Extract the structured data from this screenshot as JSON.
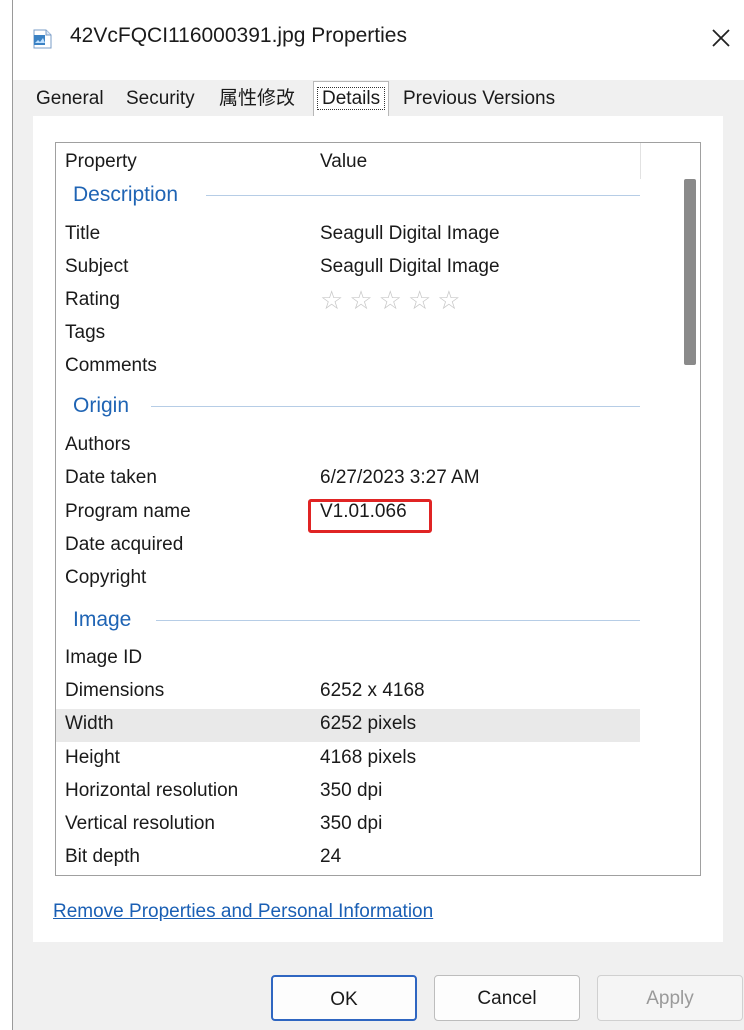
{
  "window": {
    "title": "42VcFQCI116000391.jpg Properties",
    "icon": "image-file-icon"
  },
  "tabs": [
    {
      "label": "General",
      "active": false
    },
    {
      "label": "Security",
      "active": false
    },
    {
      "label": "属性修改",
      "active": false
    },
    {
      "label": "Details",
      "active": true
    },
    {
      "label": "Previous Versions",
      "active": false
    }
  ],
  "columns": {
    "property": "Property",
    "value": "Value"
  },
  "groups": [
    {
      "label": "Description",
      "rows": [
        {
          "name": "Title",
          "value": "Seagull Digital Image"
        },
        {
          "name": "Subject",
          "value": "Seagull Digital Image"
        },
        {
          "name": "Rating",
          "value": "",
          "rating_stars": 0,
          "rating_max": 5
        },
        {
          "name": "Tags",
          "value": ""
        },
        {
          "name": "Comments",
          "value": ""
        }
      ]
    },
    {
      "label": "Origin",
      "rows": [
        {
          "name": "Authors",
          "value": ""
        },
        {
          "name": "Date taken",
          "value": "6/27/2023 3:27 AM"
        },
        {
          "name": "Program name",
          "value": "V1.01.066",
          "highlighted": true
        },
        {
          "name": "Date acquired",
          "value": ""
        },
        {
          "name": "Copyright",
          "value": ""
        }
      ]
    },
    {
      "label": "Image",
      "rows": [
        {
          "name": "Image ID",
          "value": ""
        },
        {
          "name": "Dimensions",
          "value": "6252 x 4168"
        },
        {
          "name": "Width",
          "value": "6252 pixels",
          "selected": true
        },
        {
          "name": "Height",
          "value": "4168 pixels"
        },
        {
          "name": "Horizontal resolution",
          "value": "350 dpi"
        },
        {
          "name": "Vertical resolution",
          "value": "350 dpi"
        },
        {
          "name": "Bit depth",
          "value": "24"
        }
      ]
    }
  ],
  "link": {
    "label": "Remove Properties and Personal Information"
  },
  "buttons": {
    "ok": "OK",
    "cancel": "Cancel",
    "apply": "Apply"
  },
  "colors": {
    "group_header": "#1f64b4",
    "highlight_box": "#e02424",
    "link": "#1a5fb4",
    "primary_border": "#2f66c1"
  }
}
